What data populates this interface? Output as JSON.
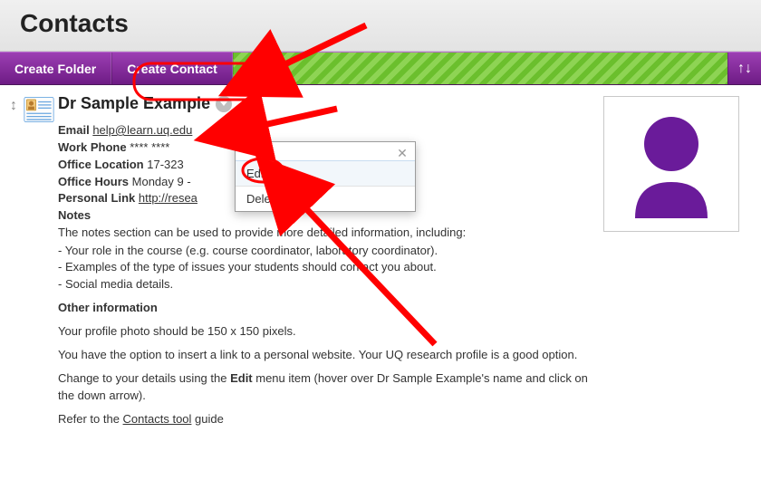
{
  "page": {
    "title": "Contacts"
  },
  "toolbar": {
    "create_folder_label": "Create Folder",
    "create_contact_label": "Create Contact",
    "sort_icon": "sort-icon"
  },
  "contact": {
    "name": "Dr Sample Example",
    "email_label": "Email",
    "email_value": "help@learn.uq.edu",
    "phone_label": "Work Phone",
    "phone_value": "**** ****",
    "location_label": "Office Location",
    "location_value": "17-323",
    "hours_label": "Office Hours",
    "hours_value": "Monday 9 -",
    "link_label": "Personal Link",
    "link_value": "http://resea",
    "notes_label": "Notes"
  },
  "notes": {
    "intro": "The notes section can be used to provide more detailed information, including:",
    "bullets": [
      "- Your role in the course (e.g. course coordinator, laboratory coordinator).",
      "- Examples of the type of issues your students should contact you about.",
      "- Social media details."
    ],
    "other_heading": "Other information",
    "p1": "Your profile photo should be 150 x 150 pixels.",
    "p2": "You have the option to insert a link to a personal website. Your UQ research profile is a good option.",
    "p3_a": "Change to your details using the ",
    "p3_b": "Edit",
    "p3_c": " menu item (hover over Dr Sample Example's name and click on the down arrow).",
    "p4_a": "Refer to the ",
    "p4_link": "Contacts tool",
    "p4_b": " guide"
  },
  "dropdown": {
    "edit": "Edit",
    "delete": "Delete"
  },
  "colors": {
    "purple": "#6a1b9a",
    "red": "#ff0000"
  }
}
